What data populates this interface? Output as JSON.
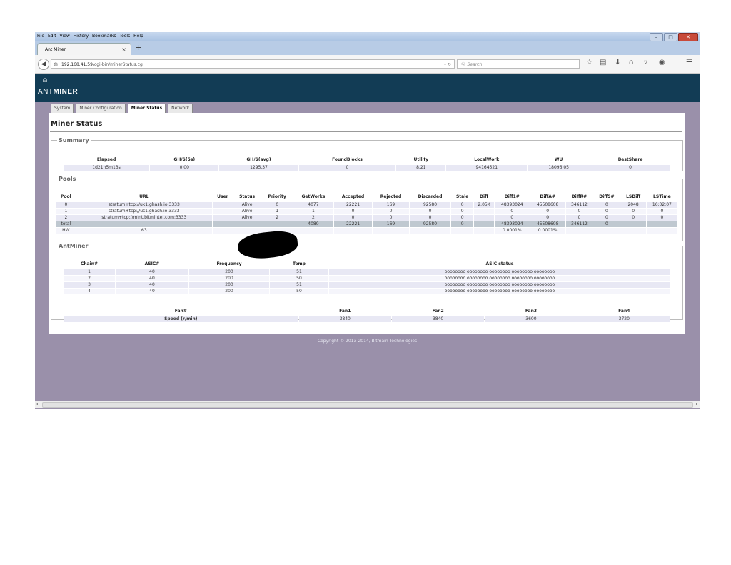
{
  "browser": {
    "menu": [
      "File",
      "Edit",
      "View",
      "History",
      "Bookmarks",
      "Tools",
      "Help"
    ],
    "window_controls": [
      "–",
      "□",
      "✕"
    ],
    "tab_title": "Ant Miner",
    "tab_close": "×",
    "new_tab": "+",
    "url_host": "192.168.41.59",
    "url_path": "/cgi-bin/minerStatus.cgi",
    "search_placeholder": "Search"
  },
  "brand": {
    "prefix": "ANT",
    "suffix": "MINER"
  },
  "nav_tabs": [
    "System",
    "Miner Configuration",
    "Miner Status",
    "Network"
  ],
  "page_title": "Miner Status",
  "summary": {
    "legend": "Summary",
    "headers": [
      "Elapsed",
      "GH/S(5s)",
      "GH/S(avg)",
      "FoundBlocks",
      "Utility",
      "LocalWork",
      "WU",
      "BestShare"
    ],
    "row": [
      "1d21h5m13s",
      "0.00",
      "1295.37",
      "0",
      "8.21",
      "94164521",
      "18096.05",
      "0"
    ]
  },
  "pools": {
    "legend": "Pools",
    "headers": [
      "Pool",
      "URL",
      "User",
      "Status",
      "Priority",
      "GetWorks",
      "Accepted",
      "Rejected",
      "Discarded",
      "Stale",
      "Diff",
      "Diff1#",
      "DiffA#",
      "DiffR#",
      "DiffS#",
      "LSDiff",
      "LSTime"
    ],
    "rows": [
      [
        "0",
        "stratum+tcp://uk1.ghash.io:3333",
        "",
        "Alive",
        "0",
        "4077",
        "22221",
        "169",
        "92580",
        "0",
        "2.05K",
        "48393024",
        "45508608",
        "346112",
        "0",
        "2048",
        "16:02:07"
      ],
      [
        "1",
        "stratum+tcp://us1.ghash.io:3333",
        "",
        "Alive",
        "1",
        "1",
        "0",
        "0",
        "0",
        "0",
        "",
        "0",
        "0",
        "0",
        "0",
        "0",
        "0"
      ],
      [
        "2",
        "stratum+tcp://mint.bitminter.com:3333",
        "",
        "Alive",
        "2",
        "2",
        "0",
        "0",
        "0",
        "0",
        "",
        "0",
        "0",
        "0",
        "0",
        "0",
        "0"
      ],
      [
        "total",
        "",
        "",
        "",
        "",
        "4080",
        "22221",
        "169",
        "92580",
        "0",
        "",
        "48393024",
        "45508608",
        "346112",
        "0",
        "",
        ""
      ]
    ],
    "hw_label": "HW",
    "hw_value": "63",
    "hw_diff1": "0.0001%",
    "hw_diffa": "0.0001%"
  },
  "antminer": {
    "legend": "AntMiner",
    "headers": [
      "Chain#",
      "ASIC#",
      "Frequency",
      "Temp",
      "ASIC status"
    ],
    "rows": [
      [
        "1",
        "40",
        "200",
        "51",
        "oooooooo oooooooo oooooooo oooooooo oooooooo"
      ],
      [
        "2",
        "40",
        "200",
        "50",
        "oooooooo oooooooo oooooooo oooooooo oooooooo"
      ],
      [
        "3",
        "40",
        "200",
        "51",
        "oooooooo oooooooo oooooooo oooooooo oooooooo"
      ],
      [
        "4",
        "40",
        "200",
        "50",
        "oooooooo oooooooo oooooooo oooooooo oooooooo"
      ]
    ],
    "fan_headers": [
      "Fan#",
      "Fan1",
      "Fan2",
      "Fan3",
      "Fan4"
    ],
    "fan_row": [
      "Speed (r/min)",
      "3840",
      "3840",
      "3600",
      "3720"
    ]
  },
  "footer": "Copyright © 2013-2014, Bitmain Technologies"
}
